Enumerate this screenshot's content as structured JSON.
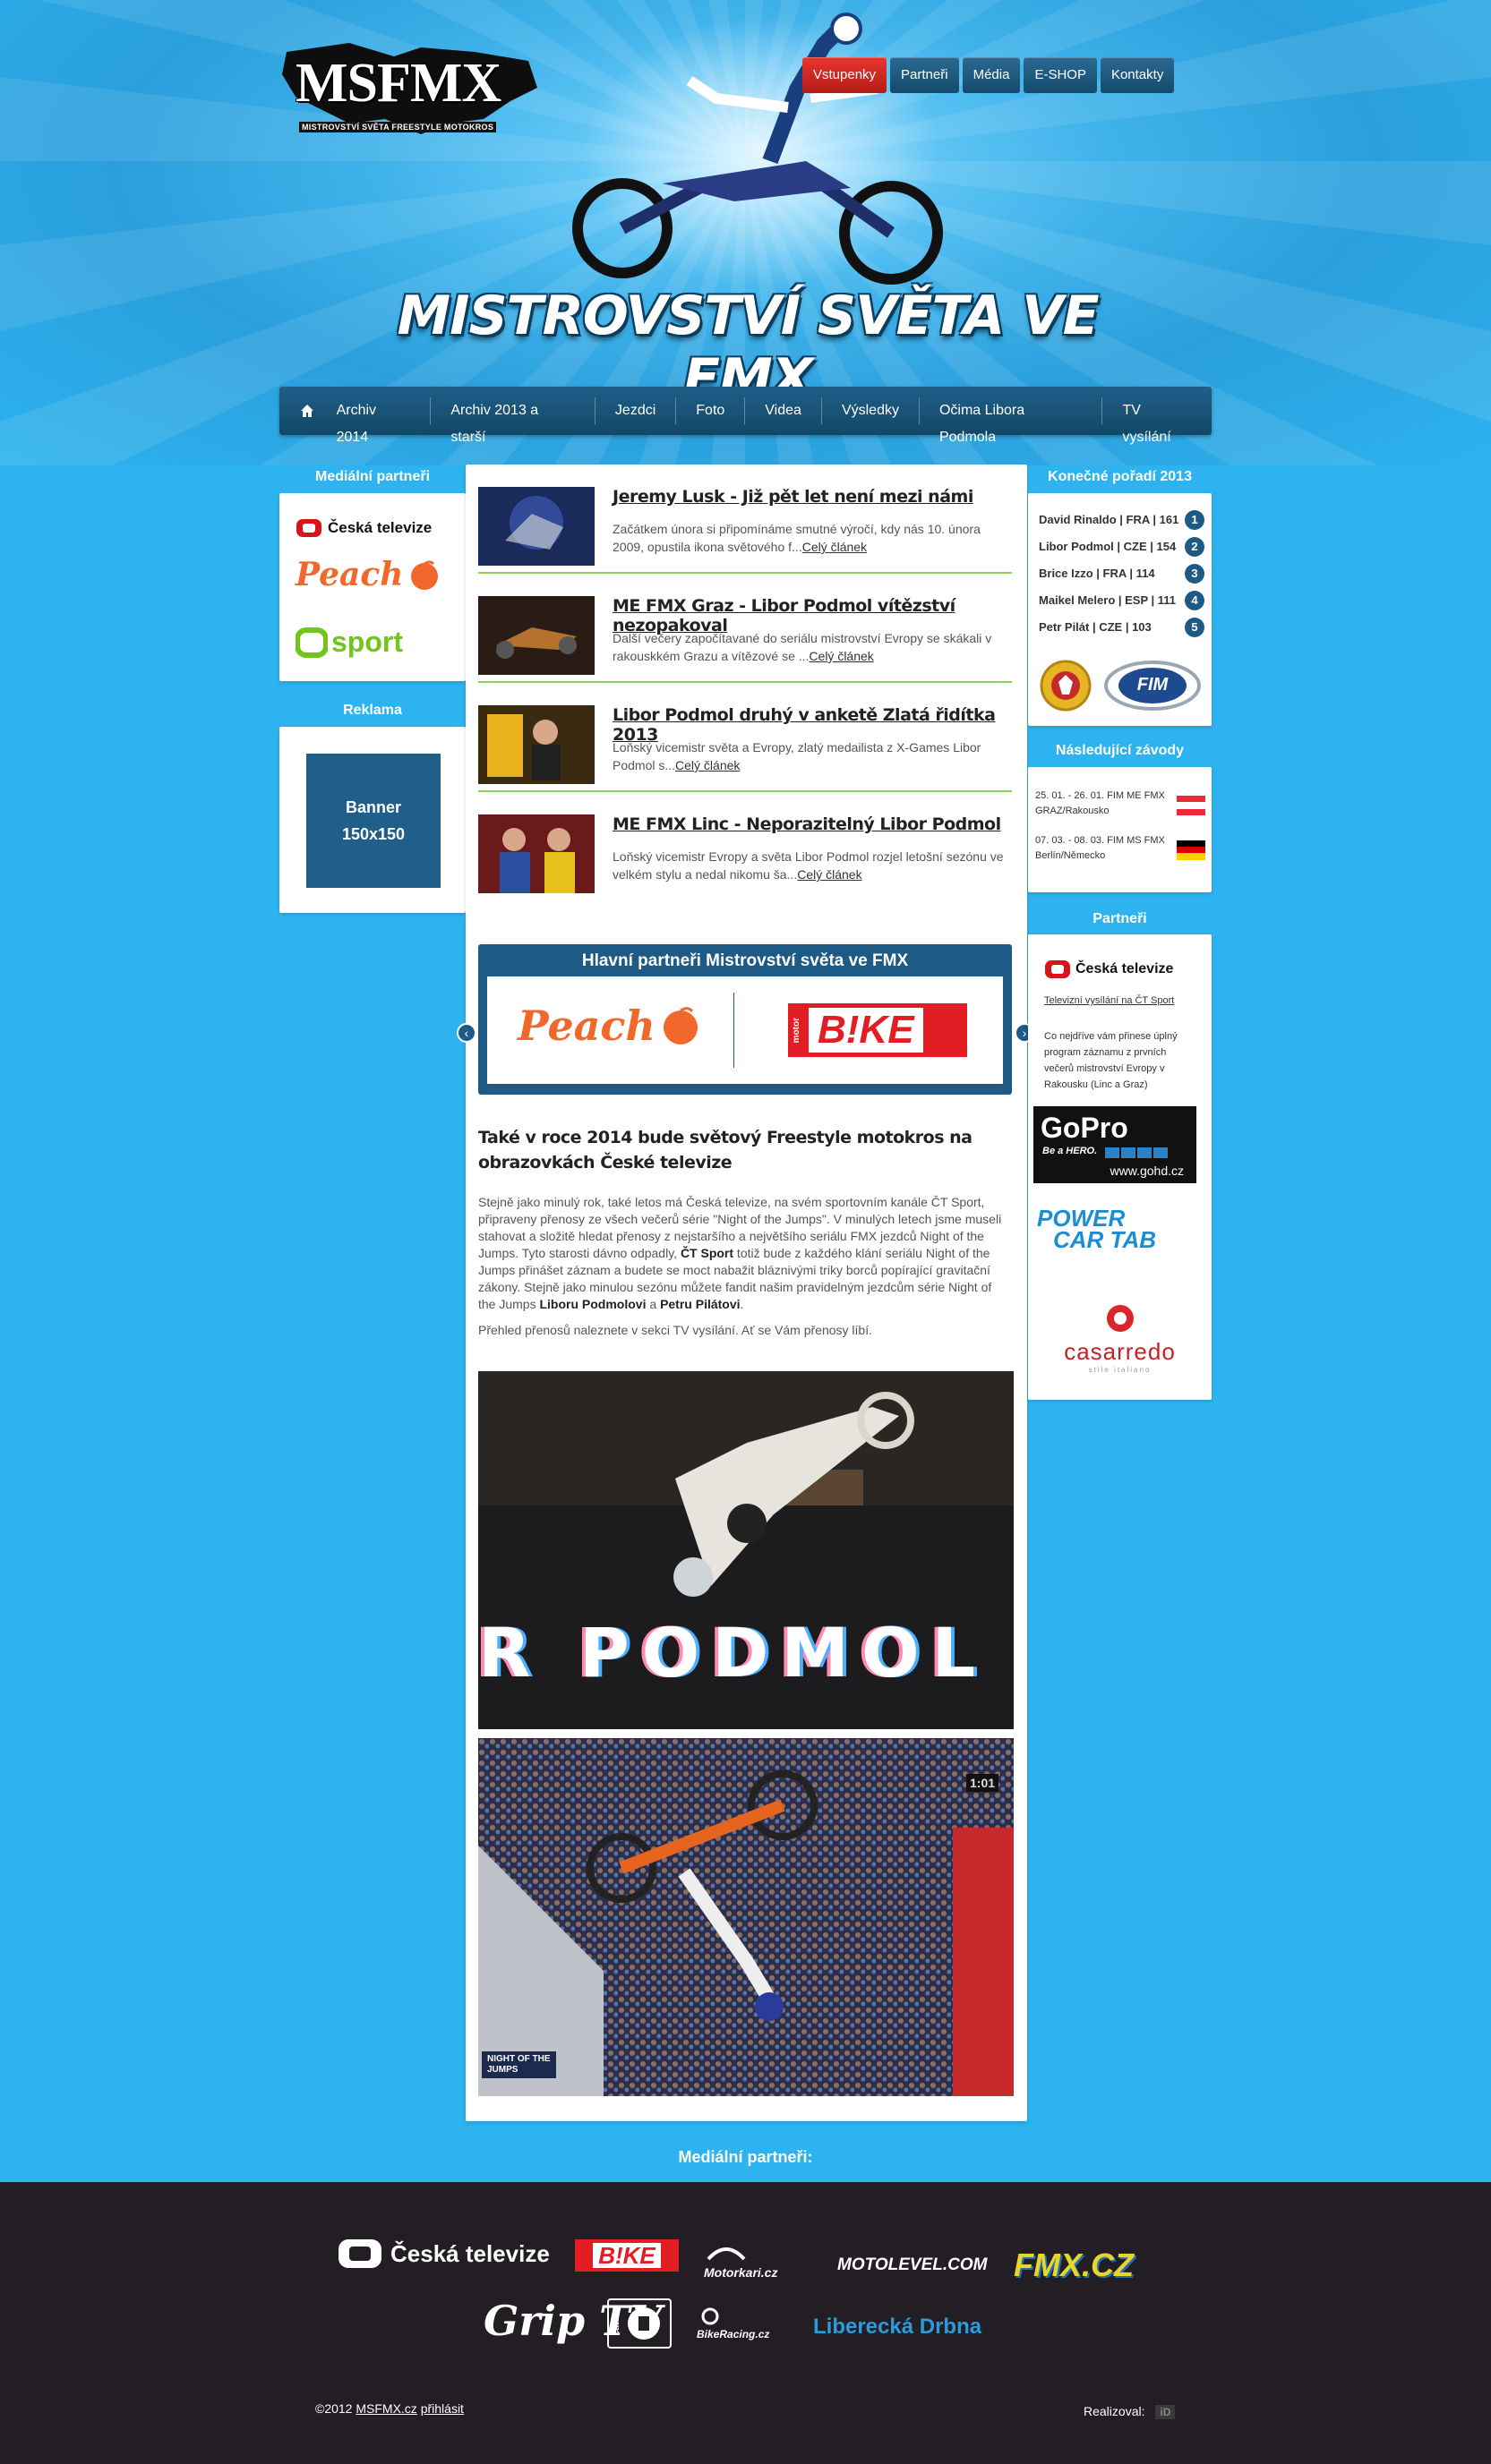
{
  "header": {
    "logo_text": "MSFMX",
    "logo_sub": "MISTROVSTVÍ SVĚTA FREESTYLE MOTOKROS",
    "title": "MISTROVSTVÍ SVĚTA VE FMX",
    "top_nav": [
      "Vstupenky",
      "Partneři",
      "Média",
      "E-SHOP",
      "Kontakty"
    ]
  },
  "main_nav": [
    "Archiv 2014",
    "Archiv 2013 a starší",
    "Jezdci",
    "Foto",
    "Videa",
    "Výsledky",
    "Očima Libora Podmola",
    "TV vysílání"
  ],
  "left": {
    "media_partners_title": "Mediální partneři",
    "media_partners": [
      "Česká televize",
      "Peach",
      "sport"
    ],
    "ad_title": "Reklama",
    "banner_line1": "Banner",
    "banner_line2": "150x150"
  },
  "news": [
    {
      "title": "Jeremy Lusk - Již pět let není mezi námi",
      "text": "Začátkem února si připomínáme smutné výročí, kdy nás 10. února 2009, opustila ikona světového f...",
      "more": "Celý článek"
    },
    {
      "title": "ME FMX Graz - Libor Podmol vítězství nezopakoval",
      "text": "Další večery započítavané do seriálu mistrovství Evropy se skákali v rakouskkém Grazu a vítězové se ...",
      "more": "Celý článek"
    },
    {
      "title": "Libor Podmol druhý v anketě Zlatá řidítka 2013",
      "text": "Loňský vicemistr světa a Evropy, zlatý medailista z X-Games Libor Podmol s...",
      "more": "Celý článek"
    },
    {
      "title": "ME FMX Linc - Neporazitelný Libor Podmol",
      "text": "Loňský vicemistr Evropy a světa Libor Podmol rozjel letošní sezónu ve velkém stylu a nedal nikomu ša...",
      "more": "Celý článek"
    }
  ],
  "main_partners": {
    "title": "Hlavní partneři Mistrovství světa ve FMX",
    "logos": [
      "Peach",
      "B!KE",
      "motor"
    ]
  },
  "article": {
    "title": "Také v roce 2014 bude světový Freestyle motokros na obrazovkách České televize",
    "p1_a": "Stejně jako minulý rok, také letos má Česká televize, na svém sportovním kanále ČT Sport, připraveny přenosy ze všech večerů série \"Night of the Jumps\". V minulých letech jsme museli stahovat a složitě hledat přenosy z nejstaršího a největšího seriálu FMX jezdců Night of the Jumps. Tyto starosti dávno odpadly, ",
    "p1_b": "ČT Sport",
    "p1_c": " totiž bude z každého klání seriálu Night of the Jumps přinášet záznam a budete se moct nabažit bláznivými triky borců popírající gravitační zákony. Stejně jako minulou sezónu můžete fandit našim pravidelným jezdcům série Night of the Jumps ",
    "p1_d": "Liboru Podmolovi",
    "p1_e": " a ",
    "p1_f": "Petru Pilátovi",
    "p1_g": ".",
    "p2": "Přehled přenosů naleznete v sekci TV vysílání. Ať se Vám přenosy líbí.",
    "photo1_text": "R PODMOL",
    "photo2_badge_line1": "NIGHT OF THE",
    "photo2_badge_line2": "JUMPS",
    "photo2_scoreboard": "1:01"
  },
  "right": {
    "rank_title": "Konečné pořadí 2013",
    "ranking": [
      {
        "name": "David Rinaldo | FRA | 161",
        "pos": "1"
      },
      {
        "name": "Libor Podmol | CZE | 154",
        "pos": "2"
      },
      {
        "name": "Brice Izzo | FRA | 114",
        "pos": "3"
      },
      {
        "name": "Maikel Melero | ESP | 111",
        "pos": "4"
      },
      {
        "name": "Petr Pilát | CZE | 103",
        "pos": "5"
      }
    ],
    "fim_label": "FIM",
    "races_title": "Následující závody",
    "races": [
      {
        "line1": "25. 01. - 26. 01. FIM ME FMX",
        "line2": "GRAZ/Rakousko"
      },
      {
        "line1": "07. 03. - 08. 03. FIM MS FMX",
        "line2": "Berlín/Německo"
      }
    ],
    "partners_title": "Partneři",
    "ct_logo": "Česká televize",
    "ct_link": "Televizní vysílání na ČT Sport",
    "ct_text": "Co nejdříve vám přinese úplný program záznamu z prvních večerů mistrovství Evropy v Rakousku (Linc a Graz)",
    "gopro": "GoPro",
    "gopro_sub": "Be a HERO.",
    "gopro_url": "www.gohd.cz",
    "powercar1": "POWER",
    "powercar2": "CAR TAB",
    "casarredo": "casarredo",
    "casarredo_sub": "stile italiano"
  },
  "footer": {
    "media_label": "Mediální partneři:",
    "logos": [
      "Česká televize",
      "B!KE",
      "Motorkari.cz",
      "MOTOLEVEL.COM",
      "FMX.CZ",
      "Grip TV",
      "catch",
      "BikeRacing.cz",
      "Liberecká Drbna"
    ],
    "copy_prefix": "©2012 ",
    "copy_link": "MSFMX.cz",
    "copy_login": "přihlásit",
    "made_by": "Realizoval:",
    "made_logo": "iD"
  }
}
